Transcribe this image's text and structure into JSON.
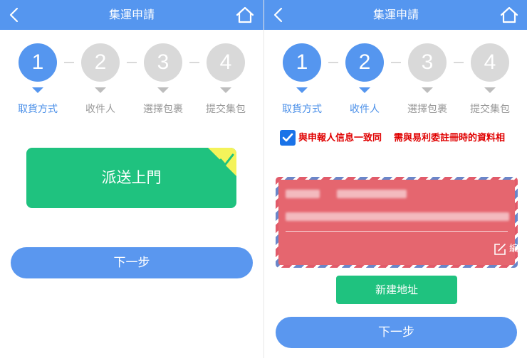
{
  "left": {
    "header": {
      "title": "集運申請",
      "back_icon": "back-chevron-icon",
      "home_icon": "home-icon"
    },
    "steps": [
      {
        "number": "1",
        "label": "取貨方式",
        "active": true
      },
      {
        "number": "2",
        "label": "收件人",
        "active": false
      },
      {
        "number": "3",
        "label": "選擇包裹",
        "active": false
      },
      {
        "number": "4",
        "label": "提交集包",
        "active": false
      }
    ],
    "delivery_option": {
      "label": "派送上門",
      "selected": true,
      "icon": "check-icon"
    },
    "next_label": "下一步"
  },
  "right": {
    "header": {
      "title": "集運申請",
      "back_icon": "back-chevron-icon",
      "home_icon": "home-icon"
    },
    "steps": [
      {
        "number": "1",
        "label": "取貨方式",
        "active": true
      },
      {
        "number": "2",
        "label": "收件人",
        "active": true
      },
      {
        "number": "3",
        "label": "選擇包裹",
        "active": false
      },
      {
        "number": "4",
        "label": "提交集包",
        "active": false
      }
    ],
    "same_as_declarant": {
      "checked": true,
      "label": "與申報人信息一致同",
      "icon": "checkbox-checked-icon"
    },
    "note": "需與易利委註冊時的資料相",
    "address_card": {
      "edit_label": "編輯",
      "edit_icon": "edit-icon"
    },
    "new_address_label": "新建地址",
    "next_label": "下一步"
  },
  "colors": {
    "primary": "#5596ef",
    "green": "#1fc27f",
    "alert_red": "#e00000",
    "address_card": "#e5666f",
    "inactive": "#d9d9d9"
  }
}
